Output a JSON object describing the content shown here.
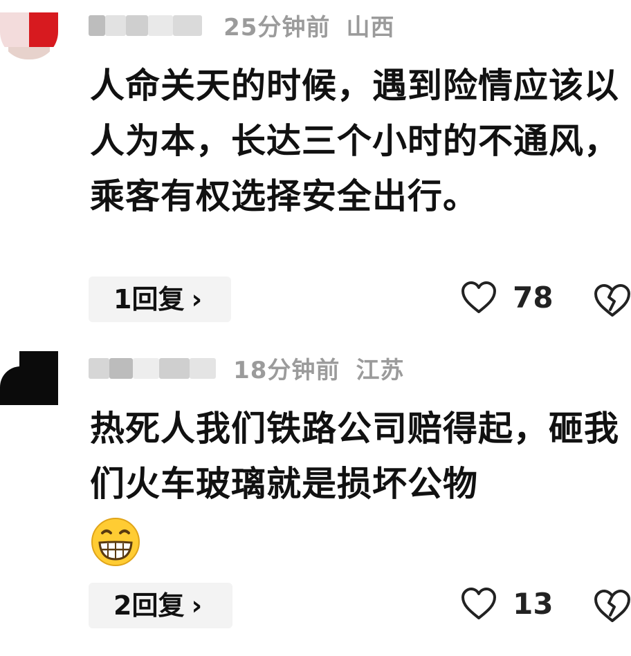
{
  "comments": [
    {
      "time": "25分钟前",
      "location": "山西",
      "text": "人命关天的时候，遇到险情应该以人为本，长达三个小时的不通风，乘客有权选择安全出行。",
      "reply_count": "1",
      "reply_word": "回复",
      "reply_arrow": "›",
      "likes": "78",
      "emoji": null
    },
    {
      "time": "18分钟前",
      "location": "江苏",
      "text": "热死人我们铁路公司赔得起，砸我们火车玻璃就是损坏公物",
      "reply_count": "2",
      "reply_word": "回复",
      "reply_arrow": "›",
      "likes": "13",
      "emoji": "grinning-face"
    }
  ],
  "colors": {
    "meta_gray": "#9b9b9b",
    "pill_bg": "#f3f3f3",
    "text": "#111111",
    "avatar_red": "#d71a1f",
    "emoji_yellow": "#ffcc33"
  },
  "icons": {
    "like": "heart-outline-icon",
    "dislike": "broken-heart-outline-icon",
    "reply_arrow": "chevron-right-icon"
  }
}
